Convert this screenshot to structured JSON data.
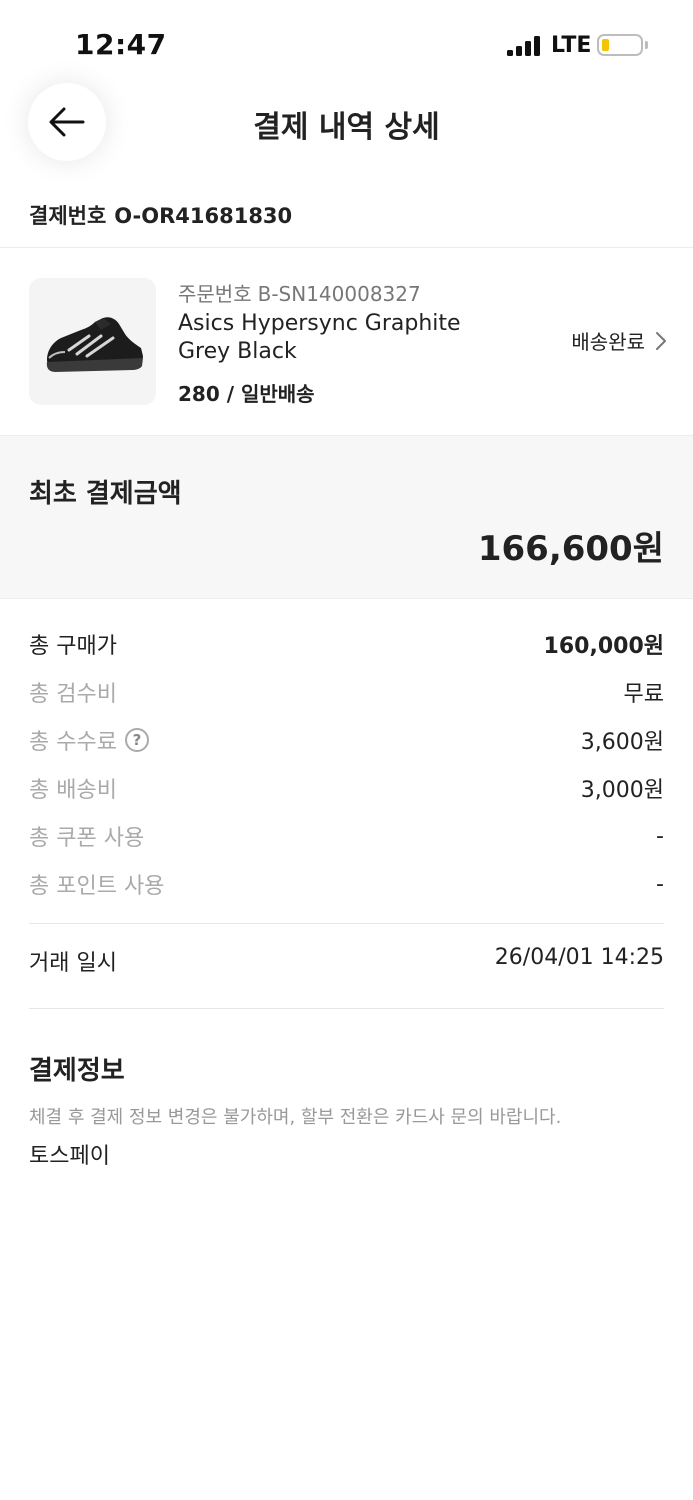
{
  "status_bar": {
    "time": "12:47",
    "network": "LTE"
  },
  "header": {
    "title": "결제 내역 상세",
    "back_icon": "arrow-left-icon"
  },
  "payment_number": {
    "label": "결제번호",
    "value": "O-OR41681830"
  },
  "order": {
    "order_number_label": "주문번호",
    "order_number": "B-SN140008327",
    "product_name": "Asics Hypersync Graphite Grey Black",
    "option": "280 / 일반배송",
    "delivery_status": "배송완료",
    "chevron_icon": "chevron-right-icon"
  },
  "total": {
    "label": "최초 결제금액",
    "amount": "166,600원"
  },
  "breakdown": [
    {
      "label": "총 구매가",
      "value": "160,000원"
    },
    {
      "label": "총 검수비",
      "value": "무료"
    },
    {
      "label": "총 수수료",
      "value": "3,600원",
      "help": "?"
    },
    {
      "label": "총 배송비",
      "value": "3,000원"
    },
    {
      "label": "총 쿠폰 사용",
      "value": "-"
    },
    {
      "label": "총 포인트 사용",
      "value": "-"
    }
  ],
  "trade": {
    "label": "거래 일시",
    "value": "26/04/01 14:25"
  },
  "payment_info": {
    "title": "결제정보",
    "notice": "체결 후 결제 정보 변경은 불가하며, 할부 전환은 카드사 문의 바랍니다.",
    "method": "토스페이"
  },
  "colors": {
    "battery": "#f5c400",
    "band_bg": "#f7f7f7",
    "muted_text": "#aaaaaa"
  }
}
